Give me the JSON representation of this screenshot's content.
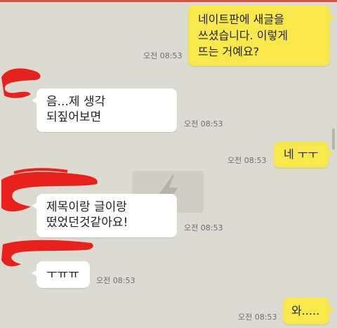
{
  "theme": {
    "background": "#dcdbd1",
    "outgoing_bubble": "#f9e84b",
    "incoming_bubble": "#ffffff",
    "timestamp_color": "#6e6d67",
    "redaction_color": "#e8211c",
    "top_edge_color": "#e05142"
  },
  "messages": [
    {
      "direction": "outgoing",
      "text": "네이트판에 새글을\n쓰셨습니다. 이렇게\n뜨는 거예요?",
      "time": "오전 08:53"
    },
    {
      "direction": "incoming",
      "text": "음...제 생각\n되짚어보면",
      "time": "오전 08:53"
    },
    {
      "direction": "outgoing",
      "text": "네 ㅜㅜ",
      "time": "오전 08:53"
    },
    {
      "direction": "incoming",
      "text": "제목이랑 글이랑\n떴었던것같아요!",
      "time": "오전 08:53"
    },
    {
      "direction": "incoming",
      "text": "ㅜㅠㅠ",
      "time": "오전 08:53"
    },
    {
      "direction": "outgoing",
      "text": "와.....",
      "time": "오전 08:53"
    }
  ],
  "overlay": {
    "watermark_icon": "lightning-logo-watermark",
    "redaction_marks": "red-scribble-redaction"
  }
}
